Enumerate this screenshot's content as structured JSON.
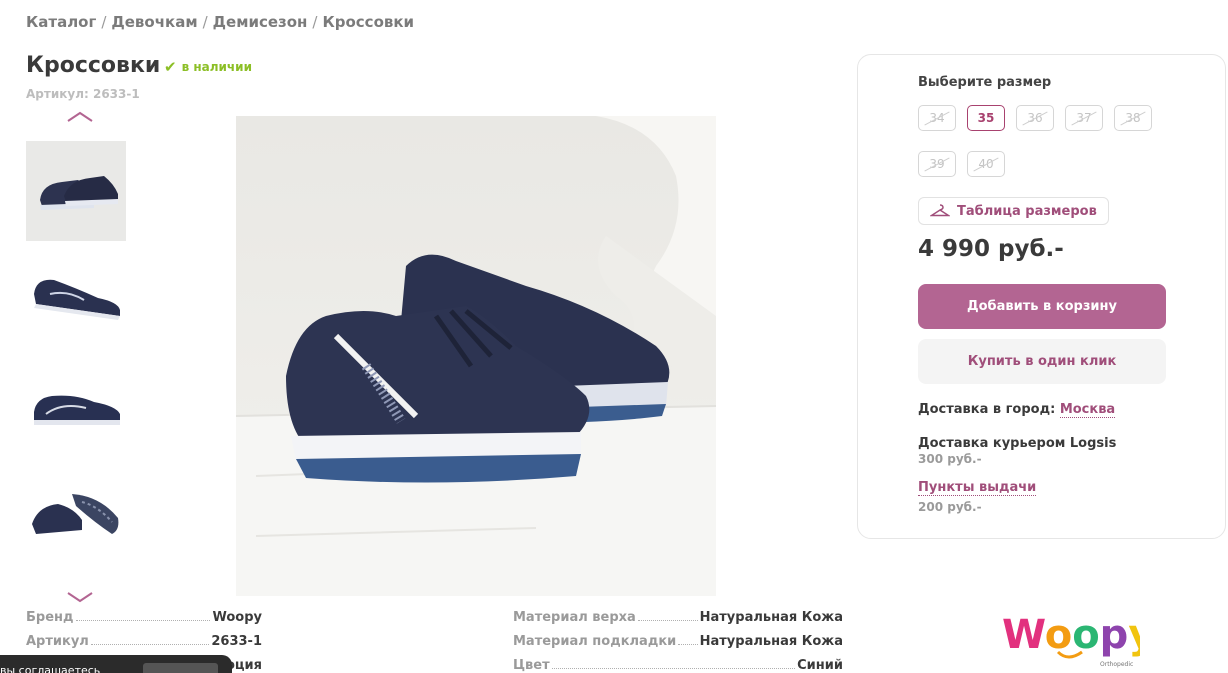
{
  "breadcrumb": [
    "Каталог",
    "Девочкам",
    "Демисезон",
    "Кроссовки"
  ],
  "product": {
    "title": "Кроссовки",
    "stock": "в наличии",
    "sku": "Артикул: 2633-1"
  },
  "thumbnails": [
    {
      "name": "thumb-pair-photo",
      "active": true
    },
    {
      "name": "thumb-side-view",
      "active": false
    },
    {
      "name": "thumb-profile-view",
      "active": false
    },
    {
      "name": "thumb-sole-view",
      "active": false
    }
  ],
  "sizes": {
    "title": "Выберите размер",
    "items": [
      {
        "label": "34",
        "available": false
      },
      {
        "label": "35",
        "available": true
      },
      {
        "label": "36",
        "available": false
      },
      {
        "label": "37",
        "available": false
      },
      {
        "label": "38",
        "available": false
      },
      {
        "label": "39",
        "available": false
      },
      {
        "label": "40",
        "available": false
      }
    ],
    "table_label": "Таблица размеров",
    "table_icon": "hanger-icon"
  },
  "price": "4 990 руб.-",
  "buttons": {
    "cart": "Добавить в корзину",
    "one_click": "Купить в один клик"
  },
  "delivery": {
    "city_label": "Доставка в город:",
    "city": "Москва",
    "courier": "Доставка курьером Logsis",
    "courier_price": "300 руб.-",
    "pickup": "Пункты выдачи",
    "pickup_price": "200 руб.-"
  },
  "specs_left": [
    {
      "label": "Бренд",
      "value": "Woopy"
    },
    {
      "label": "Артикул",
      "value": "2633-1"
    },
    {
      "label": "",
      "value": "оция"
    }
  ],
  "specs_right": [
    {
      "label": "Материал верха",
      "value": "Натуральная Кожа"
    },
    {
      "label": "Материал подкладки",
      "value": "Натуральная Кожа"
    },
    {
      "label": "Цвет",
      "value": "Синий"
    }
  ],
  "logo": {
    "text": "Woopy",
    "tagline": "Orthopedic"
  },
  "cookie": {
    "text": "вы соглашаетесь"
  },
  "colors": {
    "accent": "#b36592",
    "link": "#a04e7a",
    "stock": "#8cbf26"
  }
}
